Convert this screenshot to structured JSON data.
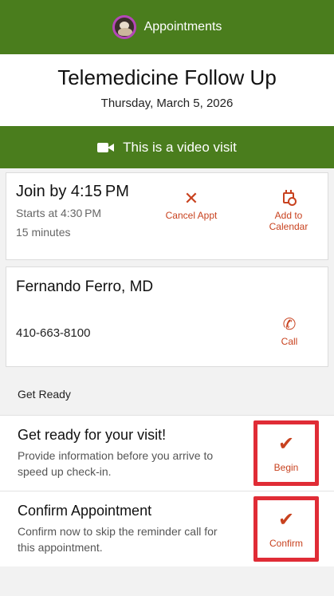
{
  "header": {
    "title": "Appointments"
  },
  "appointment": {
    "title": "Telemedicine Follow Up",
    "date": "Thursday, March 5, 2026",
    "video_banner": "This is a video visit",
    "join_by": "Join by 4:15 PM",
    "starts_at": "Starts at 4:30 PM",
    "duration": "15 minutes",
    "cancel_label": "Cancel Appt",
    "calendar_label": "Add to Calendar"
  },
  "provider": {
    "name": "Fernando Ferro, MD",
    "phone": "410-663-8100",
    "call_label": "Call"
  },
  "get_ready": {
    "section_label": "Get Ready",
    "tasks": [
      {
        "title": "Get ready for your visit!",
        "description": "Provide information before you arrive to speed up check-in.",
        "action_label": "Begin"
      },
      {
        "title": "Confirm Appointment",
        "description": "Confirm now to skip the reminder call for this appointment.",
        "action_label": "Confirm"
      }
    ]
  },
  "colors": {
    "header_green": "#4a7d1d",
    "accent_orange": "#c8421f",
    "highlight_red": "#e02c36"
  }
}
